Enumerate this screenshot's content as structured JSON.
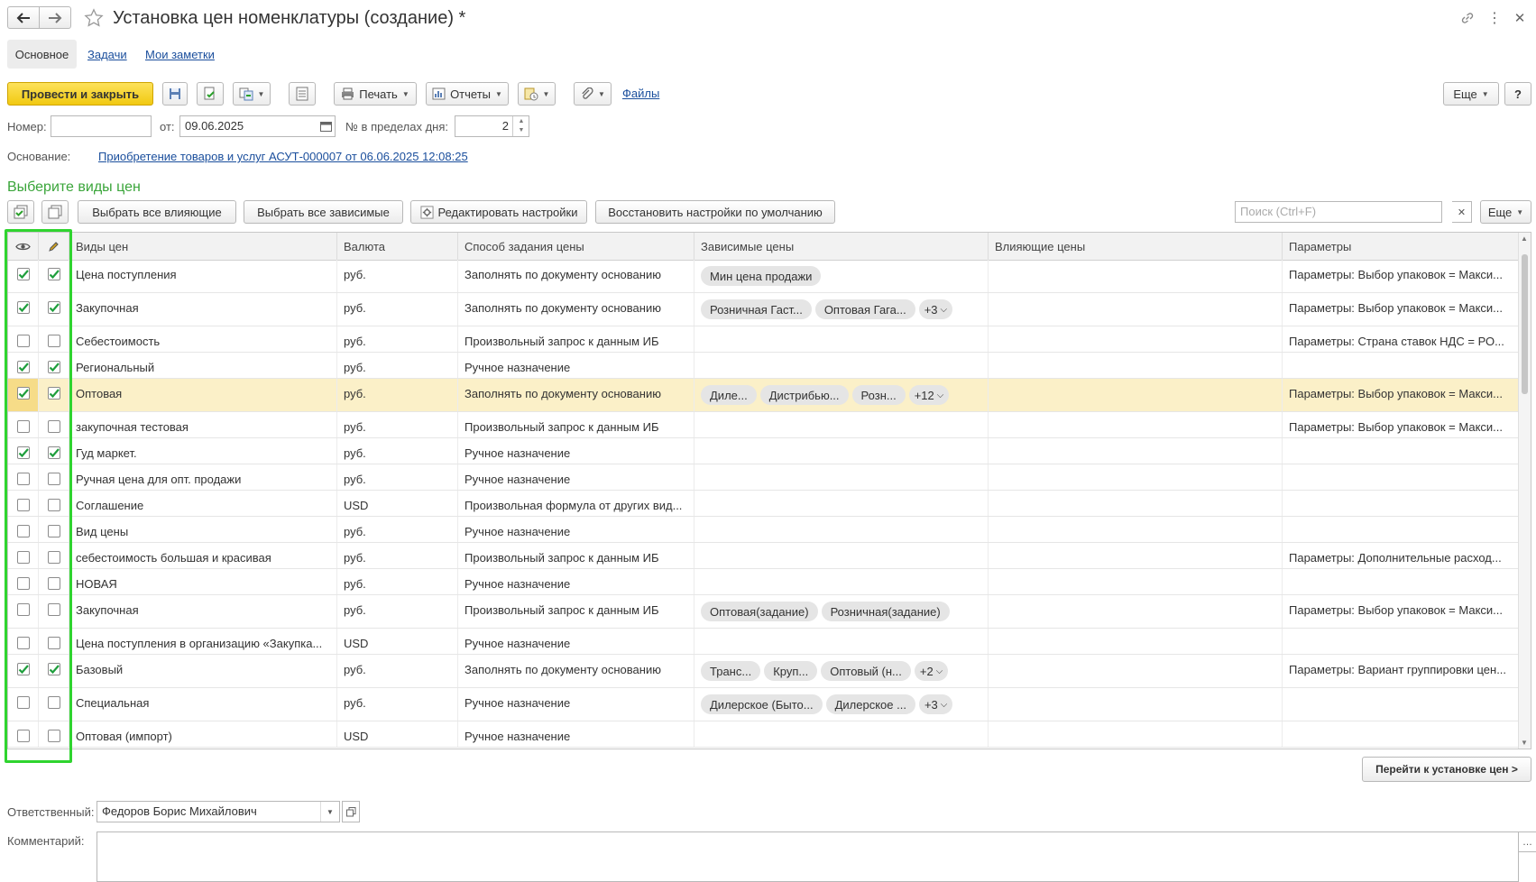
{
  "window": {
    "title": "Установка цен номенклатуры (создание) *"
  },
  "tabs": [
    {
      "label": "Основное"
    },
    {
      "label": "Задачи"
    },
    {
      "label": "Мои заметки"
    }
  ],
  "toolbar": {
    "post_close": "Провести и закрыть",
    "print": "Печать",
    "reports": "Отчеты",
    "files": "Файлы",
    "more": "Еще",
    "help": "?"
  },
  "fields": {
    "number_label": "Номер:",
    "number_value": "",
    "from_label": "от:",
    "date_value": "09.06.2025",
    "day_no_label": "№ в пределах дня:",
    "day_no_value": "2",
    "basis_label": "Основание:",
    "basis_link": "Приобретение товаров и услуг АСУТ-000007 от 06.06.2025 12:08:25"
  },
  "section": {
    "title": "Выберите виды цен",
    "select_influencing": "Выбрать все влияющие",
    "select_dependent": "Выбрать все зависимые",
    "edit_settings": "Редактировать настройки",
    "restore_defaults": "Восстановить настройки по умолчанию",
    "search_placeholder": "Поиск (Ctrl+F)",
    "more": "Еще"
  },
  "table": {
    "columns": [
      "Виды цен",
      "Валюта",
      "Способ задания цены",
      "Зависимые цены",
      "Влияющие цены",
      "Параметры"
    ],
    "rows": [
      {
        "view": true,
        "edit": true,
        "name": "Цена поступления",
        "currency": "руб.",
        "method": "Заполнять по документу основанию",
        "dependent": [
          "Мин цена продажи"
        ],
        "more": "",
        "influencing": "",
        "params": "Параметры: Выбор упаковок = Макси..."
      },
      {
        "view": true,
        "edit": true,
        "name": "Закупочная",
        "currency": "руб.",
        "method": "Заполнять по документу основанию",
        "dependent": [
          "Розничная Гаст...",
          "Оптовая Гага..."
        ],
        "more": "+3",
        "influencing": "",
        "params": "Параметры: Выбор упаковок = Макси..."
      },
      {
        "view": false,
        "edit": false,
        "name": "Себестоимость",
        "currency": "руб.",
        "method": "Произвольный запрос к данным ИБ",
        "dependent": [],
        "more": "",
        "influencing": "",
        "params": "Параметры: Страна ставок НДС = РО..."
      },
      {
        "view": true,
        "edit": true,
        "name": "Региональный",
        "currency": "руб.",
        "method": "Ручное назначение",
        "dependent": [],
        "more": "",
        "influencing": "",
        "params": ""
      },
      {
        "view": true,
        "edit": true,
        "name": "Оптовая",
        "currency": "руб.",
        "method": "Заполнять по документу основанию",
        "dependent": [
          "Диле...",
          "Дистрибью...",
          "Розн..."
        ],
        "more": "+12",
        "influencing": "",
        "params": "Параметры: Выбор упаковок = Макси...",
        "selected": true
      },
      {
        "view": false,
        "edit": false,
        "name": "закупочная тестовая",
        "currency": "руб.",
        "method": "Произвольный запрос к данным ИБ",
        "dependent": [],
        "more": "",
        "influencing": "",
        "params": "Параметры: Выбор упаковок = Макси..."
      },
      {
        "view": true,
        "edit": true,
        "name": "Гуд маркет.",
        "currency": "руб.",
        "method": "Ручное назначение",
        "dependent": [],
        "more": "",
        "influencing": "",
        "params": ""
      },
      {
        "view": false,
        "edit": false,
        "name": "Ручная цена для опт. продажи",
        "currency": "руб.",
        "method": "Ручное назначение",
        "dependent": [],
        "more": "",
        "influencing": "",
        "params": ""
      },
      {
        "view": false,
        "edit": false,
        "name": "Соглашение",
        "currency": "USD",
        "method": "Произвольная формула от других вид...",
        "dependent": [],
        "more": "",
        "influencing": "",
        "params": ""
      },
      {
        "view": false,
        "edit": false,
        "name": "Вид цены",
        "currency": "руб.",
        "method": "Ручное назначение",
        "dependent": [],
        "more": "",
        "influencing": "",
        "params": ""
      },
      {
        "view": false,
        "edit": false,
        "name": "себестоимость большая и красивая",
        "currency": "руб.",
        "method": "Произвольный запрос к данным ИБ",
        "dependent": [],
        "more": "",
        "influencing": "",
        "params": "Параметры: Дополнительные расход..."
      },
      {
        "view": false,
        "edit": false,
        "name": "НОВАЯ",
        "currency": "руб.",
        "method": "Ручное назначение",
        "dependent": [],
        "more": "",
        "influencing": "",
        "params": ""
      },
      {
        "view": false,
        "edit": false,
        "name": "Закупочная",
        "currency": "руб.",
        "method": "Произвольный запрос к данным ИБ",
        "dependent": [
          "Оптовая(задание)",
          "Розничная(задание)"
        ],
        "more": "",
        "influencing": "",
        "params": "Параметры: Выбор упаковок = Макси..."
      },
      {
        "view": false,
        "edit": false,
        "name": "Цена поступления в организацию «Закупка...",
        "currency": "USD",
        "method": "Ручное назначение",
        "dependent": [],
        "more": "",
        "influencing": "",
        "params": ""
      },
      {
        "view": true,
        "edit": true,
        "name": "Базовый",
        "currency": "руб.",
        "method": "Заполнять по документу основанию",
        "dependent": [
          "Транс...",
          "Круп...",
          "Оптовый (н..."
        ],
        "more": "+2",
        "influencing": "",
        "params": "Параметры: Вариант группировки цен..."
      },
      {
        "view": false,
        "edit": false,
        "name": "Специальная",
        "currency": "руб.",
        "method": "Ручное назначение",
        "dependent": [
          "Дилерское (Быто...",
          "Дилерское ..."
        ],
        "more": "+3",
        "influencing": "",
        "params": ""
      },
      {
        "view": false,
        "edit": false,
        "name": "Оптовая (импорт)",
        "currency": "USD",
        "method": "Ручное назначение",
        "dependent": [],
        "more": "",
        "influencing": "",
        "params": ""
      }
    ]
  },
  "footer": {
    "goto_button": "Перейти к установке цен >",
    "responsible_label": "Ответственный:",
    "responsible_value": "Федоров Борис Михайлович",
    "comment_label": "Комментарий:",
    "comment_value": ""
  },
  "colors": {
    "accent": "#f5d22e",
    "section_title": "#3aa53a",
    "highlight_box": "#2fd42f",
    "selected_row": "#fbf0c8"
  }
}
